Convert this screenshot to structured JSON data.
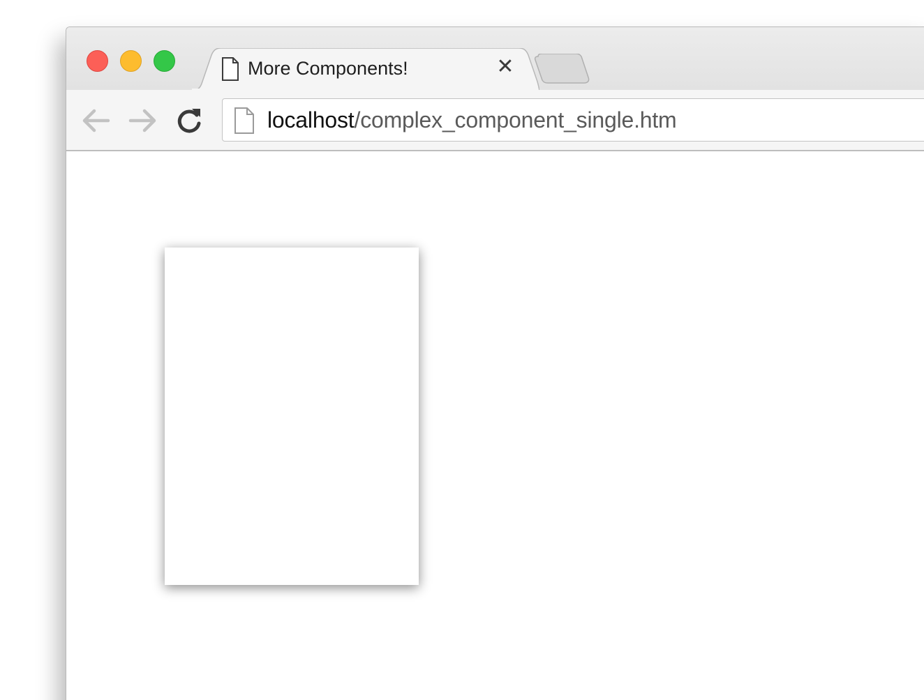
{
  "tab": {
    "title": "More Components!",
    "close_glyph": "✕"
  },
  "address_bar": {
    "host": "localhost",
    "path": "/complex_component_single.htm"
  },
  "icons": {
    "tab": "page-icon",
    "address": "page-icon",
    "back": "arrow-left-icon",
    "forward": "arrow-right-icon",
    "reload": "reload-icon"
  },
  "colors": {
    "close": "#fc5f57",
    "minimize": "#fdbc2e",
    "zoom": "#34c748"
  }
}
